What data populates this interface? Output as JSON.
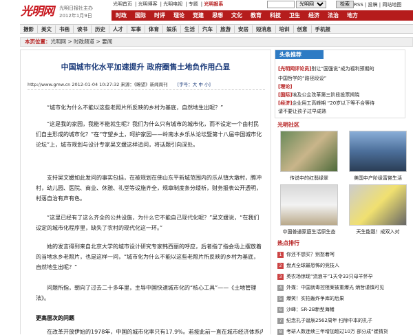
{
  "header": {
    "brand": "光明网",
    "brand_latin": "GMW.cn",
    "tagline": "光明日报社主办",
    "date": "2012年1月9日",
    "toplinks": [
      "光明首页",
      "光明博客",
      "光明电视",
      "专题",
      "光明报系"
    ],
    "search_scope": "光明网",
    "search_button": "检索",
    "rss_links": "RSS | 投稿 | 网站地图"
  },
  "mainnav": [
    "时政",
    "国际",
    "时评",
    "理论",
    "党建",
    "思想",
    "文化",
    "教育",
    "科技",
    "卫生",
    "经济",
    "法治",
    "地方",
    "论坛"
  ],
  "subnav": [
    "摄影",
    "美文",
    "书画",
    "读书",
    "历史",
    "人才",
    "军事",
    "体育",
    "娱乐",
    "生活",
    "汽车",
    "旅游",
    "安居",
    "短消息",
    "培训",
    "创意",
    "手机报"
  ],
  "breadcrumb": {
    "label": "本页位置：",
    "path": "光明网 > 时政频道 > 要闻"
  },
  "article": {
    "title": "中国城市化水平加速提升 政府圈售土地负作用凸显",
    "meta": "http://www.gmw.cn  2012-01-04 10:27:32  来源：《瞭望》新闻周刊",
    "fontsize": "[字号：大 中 小]",
    "paragraphs": [
      "“城市化为什么不能以这些老照片所反映的乡村为基底，自然地生出呢？”",
      "“这是我的家园，我能不能就生呢？我们为什么只有城市的城市化，而不设定一个由村民们自主形成的城市化？”在“守望乡土，呵护家园——岭南水乡乐从论坛暨第十八届中国城市化论坛”上，城市规划与设计专家吴文媛这样追问，将话题引向深处。",
      "支持吴文媛如此发问的事实包括，在被规划在佛山东平新城范围内的乐从镇大墩村，腾冲村，幼儿园、医院、商业、休憩、礼堂等设施齐全，规章制度条分缕析，财务报表公开透明，村落自治有声有色。",
      "“这里已经有了这么齐全的公共设施，为什么它不能自己现代化呢？”吴文媛说，“在我们设定的城市化程序里，缺失了农村的现代化这一环。”",
      "她的发言得到来自北京大学的城市设计研究专家韩西丽的呼应，后者指了指会场上摆放着的当地水乡老照片，也是这样一问，“城市化为什么不能以这些老照片所反映的乡村为基底，自然地生出呢？”",
      "问题所指，朝向了过去二十多年里，主导中国快速城市化的“核心工具”——《土地管理法》。"
    ],
    "subhead": "更高层次的问题",
    "last_line": "在改革开放伊始的1978年，中国的城市化率只有17.9%。若按此前一直在城市经济体系内"
  },
  "sidebar": {
    "headline_title": "头条推荐",
    "headlines": [
      {
        "tag": "[光明网评论员]",
        "text": "别让“国强说”成为福利预期的"
      },
      {
        "tag": "",
        "text": "中国哲学的“路径段设”"
      },
      {
        "tag": "[理论]",
        "text": ""
      },
      {
        "tag": "[国际]",
        "text": "埃及公企改革第三阶段投票揭晓"
      },
      {
        "tag": "[经济]",
        "text": "企业用工高峰期 “20岁以下等不合等待"
      },
      {
        "tag": "",
        "text": "请不要让孩子过早成熟"
      }
    ],
    "community_title": "光明社区",
    "photos": [
      {
        "caption": "传说中的红翡绿翠"
      },
      {
        "caption": "美国中产阶级富佬生活"
      },
      {
        "caption": "中国普通家庭生活原生态"
      },
      {
        "caption": "天生能靓！成双入对"
      }
    ],
    "ranking_title": "热点排行",
    "ranking": [
      "你还不想买？别愁着呵",
      "盘点全球最恐怖的竞技人",
      "英农场惊现“流浪羊”1天令33只母羊怀孕",
      "外媒：中国就毒控阻案被重爆光 炳哲谨慎可见",
      "爆笑！实拍轰炸争库的后果",
      "沙峰：SR-2B新型海鳝",
      "纪念孔子诞辰2562周年 扫除中本的孔子",
      "考研人数连续三年增加超过10万 部分成“崔猜货"
    ]
  },
  "colors": {
    "brand": "#b51c1c",
    "accent": "#2e7bc4",
    "title": "#1a3a7a"
  }
}
